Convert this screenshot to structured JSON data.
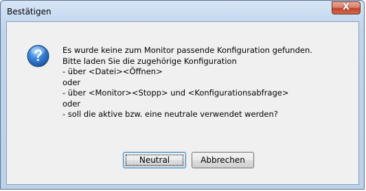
{
  "window": {
    "title": "Bestätigen"
  },
  "titlebar": {
    "close_glyph": "X",
    "close_icon": "close-icon"
  },
  "dialog": {
    "icon": "question-icon",
    "message_lines": [
      "Es wurde keine zum Monitor passende Konfiguration gefunden.",
      "Bitte laden Sie die zugehörige Konfiguration",
      "- über <Datei><Öffnen>",
      "oder",
      "- über <Monitor><Stopp> und <Konfigurationsabfrage>",
      "oder",
      "- soll die aktive bzw. eine neutrale verwendet werden?"
    ]
  },
  "buttons": {
    "neutral_label": "Neutral",
    "cancel_label": "Abbrechen"
  },
  "colors": {
    "frame": "#c4d8ee",
    "client": "#f0f0f0",
    "close_button": "#c2442b",
    "icon_blue": "#2a6fc9"
  }
}
